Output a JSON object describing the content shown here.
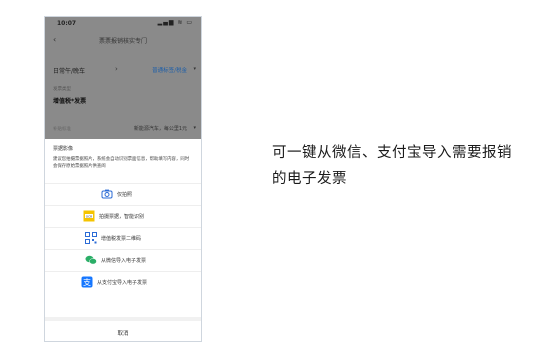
{
  "phone": {
    "status_time": "10:07",
    "status_icons": "▂▄▆ ≋ ▭",
    "nav_back": "‹",
    "nav_title": "票票报销核实专门",
    "row1_label": "日常午/晚车",
    "row1_chev": "›",
    "row1_value": "普通标签/税金",
    "row1_dropdown": "▾",
    "row2_sublabel": "发票类型",
    "row2_label": "增值税*发票",
    "row3_label": "补贴标准",
    "row3_value": "新能源汽车，每公里1元",
    "row3_dropdown": "▾",
    "sheet_title": "票据影像",
    "sheet_desc": "建议您拍摄票据照片，系统会自动识别票面信息，帮助填写内容，同时会保存原始票据照片供查阅",
    "options": [
      {
        "label": "仅拍照",
        "icon": "camera-icon"
      },
      {
        "label": "拍摄票据，智能识别",
        "icon": "ocr-icon"
      },
      {
        "label": "增值税发票二维码",
        "icon": "qrcode-icon"
      },
      {
        "label": "从微信导入电子发票",
        "icon": "wechat-icon"
      },
      {
        "label": "从支付宝导入电子发票",
        "icon": "alipay-icon"
      }
    ],
    "cancel_label": "取消"
  },
  "caption": "可一键从微信、支付宝导入需要报销的电子发票",
  "colors": {
    "accent": "#1f5fa8",
    "wechat": "#2aae67",
    "alipay": "#1677ff",
    "ocr": "#f5c400"
  }
}
